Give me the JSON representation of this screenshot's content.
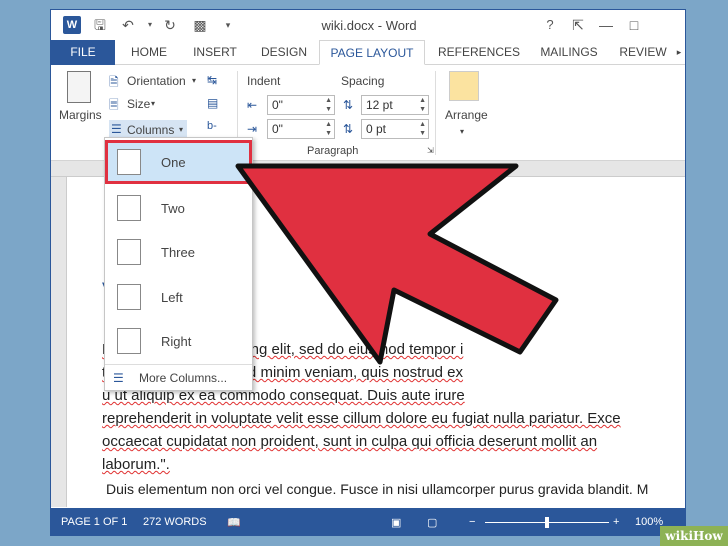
{
  "window": {
    "title": "wiki.docx - Word",
    "toolbar": {
      "word_logo": "W",
      "help": "?"
    }
  },
  "tabs": [
    "FILE",
    "HOME",
    "INSERT",
    "DESIGN",
    "PAGE LAYOUT",
    "REFERENCES",
    "MAILINGS",
    "REVIEW"
  ],
  "ribbon": {
    "margins": "Margins",
    "orientation": "Orientation",
    "size": "Size",
    "columns": "Columns",
    "indent_header": "Indent",
    "spacing_header": "Spacing",
    "indent_left": "0\"",
    "indent_right": "0\"",
    "spacing_before": "12 pt",
    "spacing_after": "0 pt",
    "paragraph_group": "Paragraph",
    "arrange": "Arrange"
  },
  "columns_menu": {
    "items": [
      "One",
      "Two",
      "Three",
      "Left",
      "Right"
    ],
    "more": "More Columns...",
    "selected": "One"
  },
  "document": {
    "heading_letter": "V",
    "lines": [
      "L          amet, consectetu         scing elit, sed do eiusmod tempor i",
      "t         nagna aliqua. Ut eni      d minim veniam, quis nostrud ex",
      "u         ut aliquip ex ea commodo consequat. Duis aute irure",
      "reprehenderit in voluptate velit esse cillum dolore eu fugiat nulla pariatur. Exce",
      "occaecat cupidatat non proident, sunt in culpa qui officia deserunt mollit an",
      "laborum.\".",
      "Duis elementum non orci vel congue. Fusce in nisi ullamcorper purus gravida blandit. M"
    ]
  },
  "status": {
    "page": "PAGE 1 OF 1",
    "words": "272 WORDS",
    "zoom": "100%"
  },
  "badge": "wikiHow",
  "colors": {
    "accent": "#2b579a",
    "highlight": "#e03040"
  }
}
